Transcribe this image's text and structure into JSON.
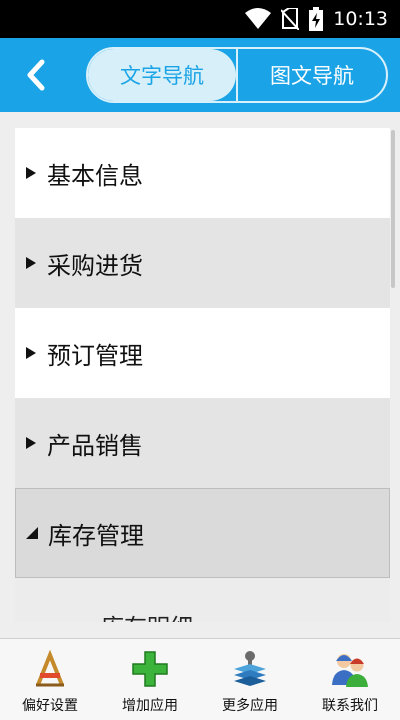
{
  "status_bar": {
    "time": "10:13",
    "icons": [
      "wifi-icon",
      "no-sim-icon",
      "battery-charging-icon"
    ]
  },
  "header": {
    "back_icon": "back-arrow-icon",
    "tabs": [
      {
        "label": "文字导航",
        "active": true
      },
      {
        "label": "图文导航",
        "active": false
      }
    ],
    "accent": "#1aa3e6"
  },
  "menu": {
    "items": [
      {
        "label": "基本信息",
        "expanded": false
      },
      {
        "label": "采购进货",
        "expanded": false
      },
      {
        "label": "预订管理",
        "expanded": false
      },
      {
        "label": "产品销售",
        "expanded": false
      },
      {
        "label": "库存管理",
        "expanded": true
      }
    ],
    "subitems": [
      {
        "label": "库存明细"
      }
    ]
  },
  "bottom_nav": [
    {
      "label": "偏好设置",
      "icon": "tools-icon"
    },
    {
      "label": "增加应用",
      "icon": "plus-icon"
    },
    {
      "label": "更多应用",
      "icon": "books-icon"
    },
    {
      "label": "联系我们",
      "icon": "contacts-icon"
    }
  ]
}
